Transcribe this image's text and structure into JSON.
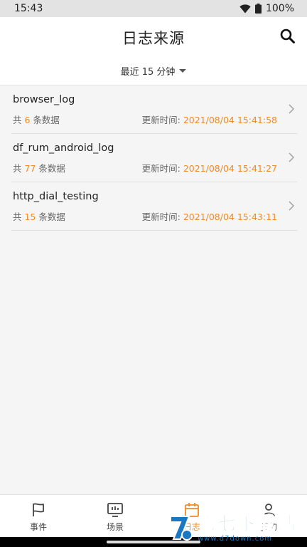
{
  "status_bar": {
    "time": "15:43",
    "battery": "100%"
  },
  "header": {
    "title": "日志来源",
    "filter_label": "最近 15 分钟"
  },
  "rows": [
    {
      "name": "browser_log",
      "count_prefix": "共 ",
      "count": "6",
      "count_suffix": " 条数据",
      "update_label": "更新时间: ",
      "update_time": "2021/08/04 15:41:58"
    },
    {
      "name": "df_rum_android_log",
      "count_prefix": "共 ",
      "count": "77",
      "count_suffix": " 条数据",
      "update_label": "更新时间: ",
      "update_time": "2021/08/04 15:41:27"
    },
    {
      "name": "http_dial_testing",
      "count_prefix": "共 ",
      "count": "15",
      "count_suffix": " 条数据",
      "update_label": "更新时间: ",
      "update_time": "2021/08/04 15:43:11"
    }
  ],
  "tabs": [
    {
      "label": "事件",
      "icon": "flag-icon"
    },
    {
      "label": "场景",
      "icon": "monitor-icon"
    },
    {
      "label": "日志",
      "icon": "calendar-icon"
    },
    {
      "label": "我的",
      "icon": "user-icon"
    }
  ],
  "watermark": {
    "main": "第七下载站",
    "url": "www.d7down.com"
  },
  "colors": {
    "accent": "#f08a24",
    "watermark": "#1a78c2"
  }
}
